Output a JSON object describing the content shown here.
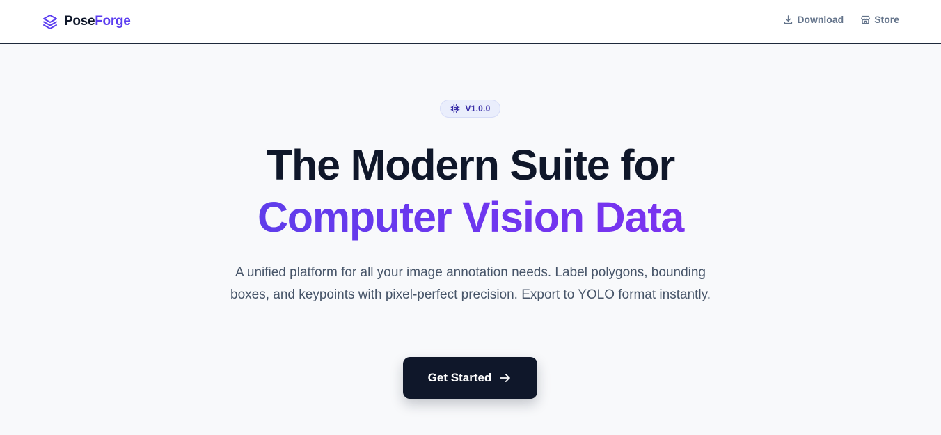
{
  "header": {
    "brand": {
      "part1": "Pose",
      "part2": "Forge",
      "icon": "layers-icon"
    },
    "nav": [
      {
        "label": "Download",
        "icon": "download-icon"
      },
      {
        "label": "Store",
        "icon": "store-icon"
      }
    ]
  },
  "hero": {
    "badge": {
      "label": "V1.0.0",
      "icon": "chip-icon"
    },
    "title_line1": "The Modern Suite for",
    "title_line2": "Computer Vision Data",
    "subtitle": "A unified platform for all your image annotation needs. Label polygons, bounding boxes, and keypoints with pixel-perfect precision. Export to YOLO format instantly.",
    "cta": {
      "label": "Get Started",
      "icon": "arrow-right-icon"
    }
  },
  "colors": {
    "brand_accent": "#5b3df0",
    "gradient_start": "#4f46e5",
    "gradient_end": "#8b2ff0",
    "dark": "#0f172a",
    "muted": "#64748b",
    "background": "#f8f9fb"
  }
}
